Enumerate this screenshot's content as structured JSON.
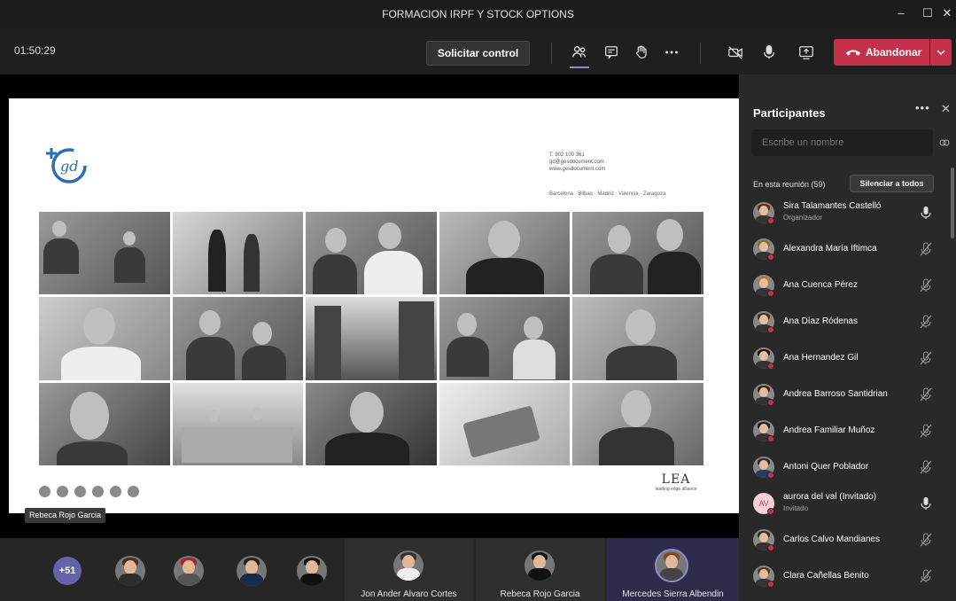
{
  "window": {
    "title": "FORMACION IRPF Y STOCK OPTIONS",
    "minimize": "–",
    "maximize": "☐",
    "close": "✕"
  },
  "toolbar": {
    "timer": "01:50:29",
    "request_control": "Solicitar control",
    "leave": "Abandonar",
    "icons": [
      "participants-icon",
      "chat-icon",
      "raise-hand-icon",
      "more-icon",
      "camera-off-icon",
      "mic-icon",
      "share-icon"
    ]
  },
  "slide": {
    "logo_text": "gd",
    "contact": [
      "T. 902 100 361",
      "gd@gesdocument.com",
      "www.gesdocument.com"
    ],
    "cities": "Barcelona · Bilbao · Madrid · Valencia · Zaragoza",
    "brand_mark": "LEA",
    "brand_sub": "leading edge alliance"
  },
  "caption": "Rebeca Rojo Garcia",
  "bottom_bar": {
    "overflow_badge": "+51",
    "tiles": [
      {
        "name": "Jon Ander Álvaro Cortes"
      },
      {
        "name": "Rebeca Rojo Garcia"
      },
      {
        "name": "Mercedes Sierra Albendin"
      }
    ]
  },
  "panel": {
    "title": "Participantes",
    "more": "•••",
    "close": "✕",
    "search_placeholder": "Escribe un nombre",
    "meeting_label": "En esta reunión (59)",
    "mute_all": "Silenciar a todos",
    "participants": [
      {
        "name": "Sira Talamantes Castelló",
        "role": "Organizador",
        "mic": "on"
      },
      {
        "name": "Alexandra María Iftimca",
        "role": "",
        "mic": "off"
      },
      {
        "name": "Ana Cuenca Pérez",
        "role": "",
        "mic": "off"
      },
      {
        "name": "Ana Díaz Ródenas",
        "role": "",
        "mic": "off"
      },
      {
        "name": "Ana Hernandez Gil",
        "role": "",
        "mic": "off"
      },
      {
        "name": "Andrea Barroso Santidrian",
        "role": "",
        "mic": "off"
      },
      {
        "name": "Andrea Familiar Muñoz",
        "role": "",
        "mic": "off"
      },
      {
        "name": "Antoni Quer Poblador",
        "role": "",
        "mic": "off"
      },
      {
        "name": "aurora del val (Invitado)",
        "role": "Invitado",
        "mic": "on",
        "initials": "AV"
      },
      {
        "name": "Carlos Calvo Mandianes",
        "role": "",
        "mic": "off"
      },
      {
        "name": "Clara Cañellas Benito",
        "role": "",
        "mic": "off"
      }
    ]
  },
  "colors": {
    "accent": "#6264a7",
    "leave": "#c4314b",
    "panel_bg": "#292929",
    "app_bg": "#1f1f1f"
  }
}
